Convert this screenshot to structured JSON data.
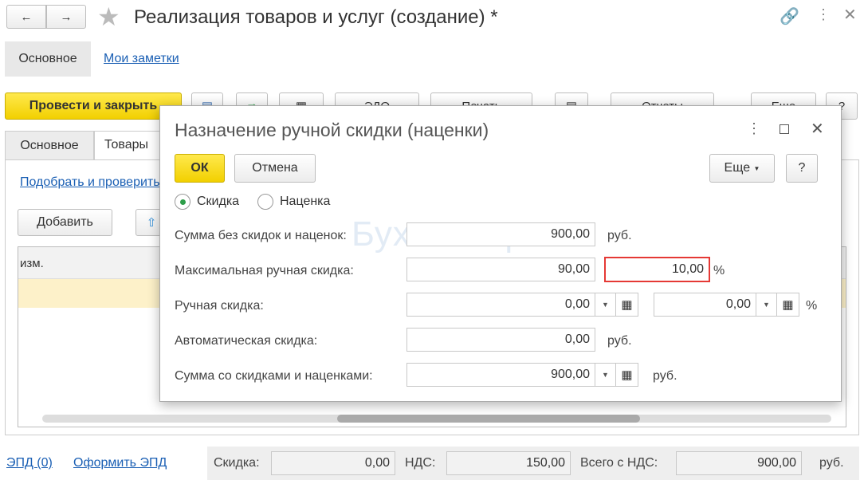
{
  "window": {
    "title": "Реализация товаров и услуг (создание) *"
  },
  "nav": {
    "main": "Основное",
    "notes": "Мои заметки"
  },
  "toolbar": {
    "post_close": "Провести и закрыть",
    "edo": "ЭДО",
    "print": "Печать",
    "reports": "Отчеты",
    "more": "Еще",
    "help": "?"
  },
  "tabs": [
    "Основное",
    "Товары"
  ],
  "goods": {
    "pick_link": "Подобрать и проверить",
    "add": "Добавить",
    "col_unit": "изм."
  },
  "footer": {
    "epd": "ЭПД (0)",
    "make_epd": "Оформить ЭПД",
    "discount_label": "Скидка:",
    "discount": "0,00",
    "vat_label": "НДС:",
    "vat": "150,00",
    "total_label": "Всего с НДС:",
    "total": "900,00",
    "currency": "руб."
  },
  "dialog": {
    "title": "Назначение ручной скидки (наценки)",
    "ok": "ОК",
    "cancel": "Отмена",
    "more": "Еще",
    "help": "?",
    "radio_discount": "Скидка",
    "radio_markup": "Наценка",
    "selected": "Скидка",
    "sum_no_disc_label": "Сумма без скидок и наценок:",
    "sum_no_disc": "900,00",
    "max_manual_label": "Максимальная ручная скидка:",
    "max_manual": "90,00",
    "max_manual_pct": "10,00",
    "manual_label": "Ручная скидка:",
    "manual": "0,00",
    "manual_pct": "0,00",
    "auto_label": "Автоматическая скидка:",
    "auto": "0,00",
    "sum_with_label": "Сумма со скидками и наценками:",
    "sum_with": "900,00",
    "rub": "руб.",
    "pct": "%"
  },
  "watermark": "Бухэксперт",
  "colors": {
    "accent_yellow": "#f5d800",
    "highlight_red": "#e53935",
    "radio_green": "#2e9e4a"
  }
}
